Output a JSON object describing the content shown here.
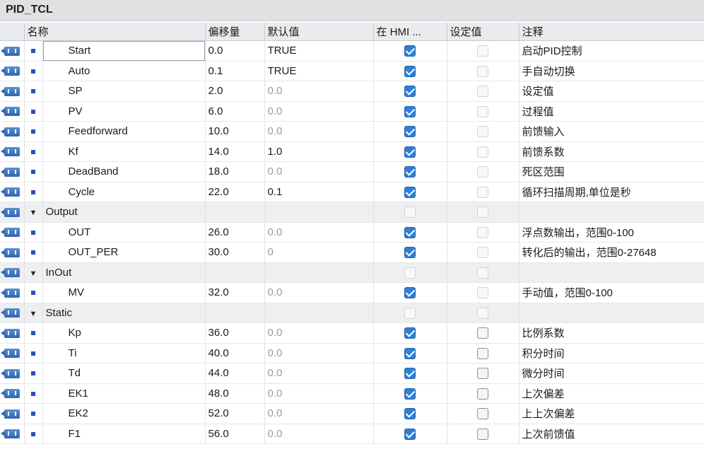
{
  "window": {
    "title": "PID_TCL"
  },
  "columns": {
    "name": "名称",
    "offset": "偏移量",
    "default": "默认值",
    "hmi": "在 HMI ...",
    "setpoint": "设定值",
    "comment": "注释"
  },
  "rows": [
    {
      "kind": "leaf",
      "name": "Start",
      "offset": "0.0",
      "default": "TRUE",
      "default_dim": false,
      "hmi": true,
      "setp": false,
      "setp_faint": true,
      "comment": "启动PID控制",
      "selected": true
    },
    {
      "kind": "leaf",
      "name": "Auto",
      "offset": "0.1",
      "default": "TRUE",
      "default_dim": false,
      "hmi": true,
      "setp": false,
      "setp_faint": true,
      "comment": "手自动切换"
    },
    {
      "kind": "leaf",
      "name": "SP",
      "offset": "2.0",
      "default": "0.0",
      "default_dim": true,
      "hmi": true,
      "setp": false,
      "setp_faint": true,
      "comment": "设定值"
    },
    {
      "kind": "leaf",
      "name": "PV",
      "offset": "6.0",
      "default": "0.0",
      "default_dim": true,
      "hmi": true,
      "setp": false,
      "setp_faint": true,
      "comment": "过程值"
    },
    {
      "kind": "leaf",
      "name": "Feedforward",
      "offset": "10.0",
      "default": "0.0",
      "default_dim": true,
      "hmi": true,
      "setp": false,
      "setp_faint": true,
      "comment": "前馈输入"
    },
    {
      "kind": "leaf",
      "name": "Kf",
      "offset": "14.0",
      "default": "1.0",
      "default_dim": false,
      "hmi": true,
      "setp": false,
      "setp_faint": true,
      "comment": "前馈系数"
    },
    {
      "kind": "leaf",
      "name": "DeadBand",
      "offset": "18.0",
      "default": "0.0",
      "default_dim": true,
      "hmi": true,
      "setp": false,
      "setp_faint": true,
      "comment": "死区范围"
    },
    {
      "kind": "leaf",
      "name": "Cycle",
      "offset": "22.0",
      "default": "0.1",
      "default_dim": false,
      "hmi": true,
      "setp": false,
      "setp_faint": true,
      "comment": "循环扫描周期,单位是秒"
    },
    {
      "kind": "group",
      "name": "Output"
    },
    {
      "kind": "leaf",
      "name": "OUT",
      "offset": "26.0",
      "default": "0.0",
      "default_dim": true,
      "hmi": true,
      "setp": false,
      "setp_faint": true,
      "comment": "浮点数输出，范围0-100"
    },
    {
      "kind": "leaf",
      "name": "OUT_PER",
      "offset": "30.0",
      "default": "0",
      "default_dim": true,
      "hmi": true,
      "setp": false,
      "setp_faint": true,
      "comment": "转化后的输出，范围0-27648"
    },
    {
      "kind": "group",
      "name": "InOut"
    },
    {
      "kind": "leaf",
      "name": "MV",
      "offset": "32.0",
      "default": "0.0",
      "default_dim": true,
      "hmi": true,
      "setp": false,
      "setp_faint": true,
      "comment": "手动值，范围0-100"
    },
    {
      "kind": "group",
      "name": "Static"
    },
    {
      "kind": "leaf",
      "name": "Kp",
      "offset": "36.0",
      "default": "0.0",
      "default_dim": true,
      "hmi": true,
      "setp": false,
      "setp_faint": false,
      "comment": "比例系数"
    },
    {
      "kind": "leaf",
      "name": "Ti",
      "offset": "40.0",
      "default": "0.0",
      "default_dim": true,
      "hmi": true,
      "setp": false,
      "setp_faint": false,
      "comment": "积分时间"
    },
    {
      "kind": "leaf",
      "name": "Td",
      "offset": "44.0",
      "default": "0.0",
      "default_dim": true,
      "hmi": true,
      "setp": false,
      "setp_faint": false,
      "comment": "微分时间"
    },
    {
      "kind": "leaf",
      "name": "EK1",
      "offset": "48.0",
      "default": "0.0",
      "default_dim": true,
      "hmi": true,
      "setp": false,
      "setp_faint": false,
      "comment": "上次偏差"
    },
    {
      "kind": "leaf",
      "name": "EK2",
      "offset": "52.0",
      "default": "0.0",
      "default_dim": true,
      "hmi": true,
      "setp": false,
      "setp_faint": false,
      "comment": "上上次偏差"
    },
    {
      "kind": "leaf",
      "name": "F1",
      "offset": "56.0",
      "default": "0.0",
      "default_dim": true,
      "hmi": true,
      "setp": false,
      "setp_faint": false,
      "comment": "上次前馈值"
    }
  ],
  "icons": {
    "interface": "interface-param-icon",
    "bullet": "bullet-icon",
    "expand": "expand-triangle-icon"
  },
  "colors": {
    "header_bg": "#e9ebee",
    "checkbox_on": "#2e7fd6",
    "section_bg": "#eeeff0"
  }
}
